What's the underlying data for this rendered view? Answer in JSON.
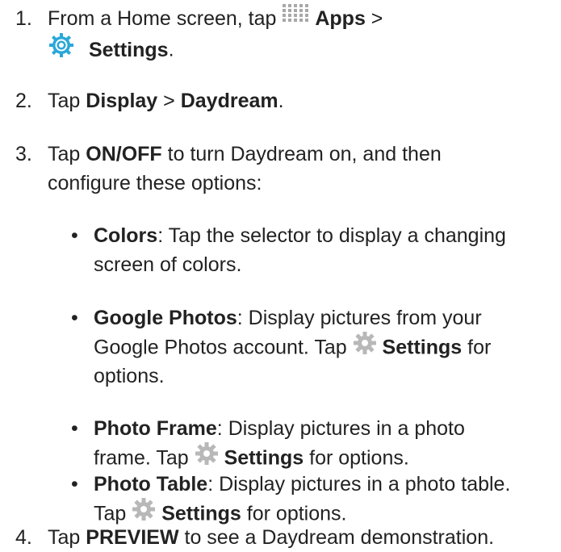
{
  "steps": [
    {
      "number": "1.",
      "lines": [
        {
          "text1": "From a Home screen, tap ",
          "icon": "apps-grid-icon",
          "bold": "Apps",
          "text2": " >"
        },
        {
          "icon": "settings-app-icon",
          "bold": "Settings",
          "text2": "."
        }
      ]
    },
    {
      "number": "2.",
      "text1": "Tap ",
      "bold1": "Display",
      "text2": " > ",
      "bold2": "Daydream",
      "text3": "."
    },
    {
      "number": "3.",
      "line1_text1": "Tap ",
      "line1_bold": "ON/OFF",
      "line1_text2": " to turn Daydream on, and then",
      "line2": "configure these options:",
      "options": [
        {
          "bold": "Colors",
          "line1": ": Tap the selector to display a changing",
          "line2": "screen of colors."
        },
        {
          "bold": "Google Photos",
          "line1": ": Display pictures from your",
          "line2_text1": "Google Photos account. Tap ",
          "line2_bold": "Settings",
          "line2_text2": " for",
          "line3": "options."
        },
        {
          "bold": "Photo Frame",
          "line1": ": Display pictures in a photo",
          "line2_text1": "frame. Tap ",
          "line2_bold": "Settings",
          "line2_text2": " for options."
        },
        {
          "bold": "Photo Table",
          "line1": ": Display pictures in a photo table.",
          "line2_text1": "Tap ",
          "line2_bold": "Settings",
          "line2_text2": " for options."
        }
      ]
    },
    {
      "number": "4.",
      "text1": "Tap ",
      "bold": "PREVIEW",
      "text2": " to see a Daydream demonstration."
    }
  ],
  "icons": {
    "apps_grid_color": "#a8a8a8",
    "settings_app_color": "#2aa8d8",
    "gear_color": "#b8b8b8"
  }
}
